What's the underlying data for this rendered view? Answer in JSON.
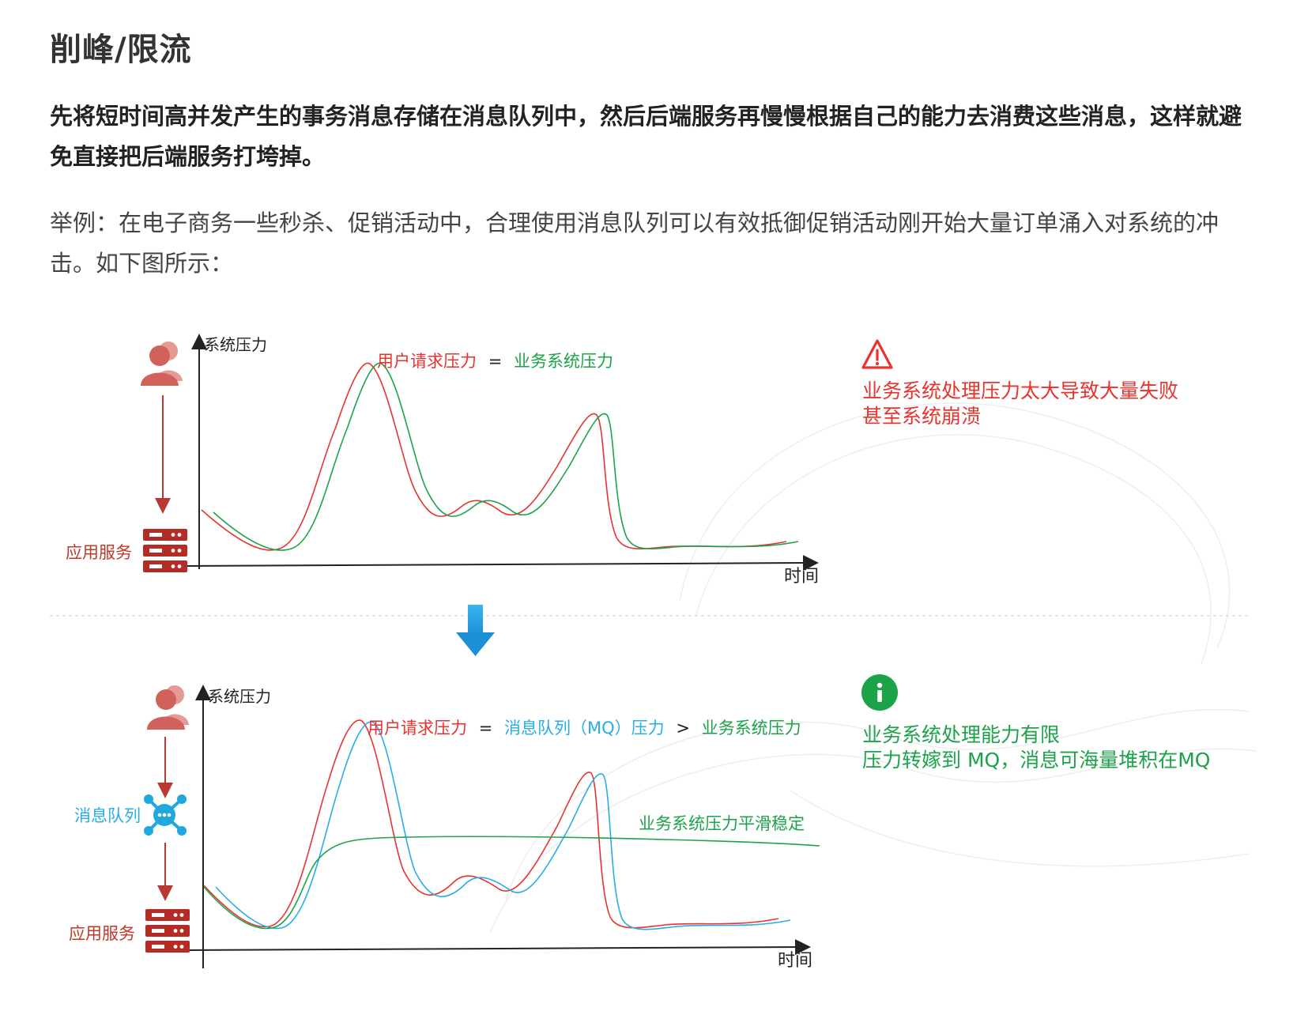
{
  "article": {
    "title": "削峰/限流",
    "lead": "先将短时间高并发产生的事务消息存储在消息队列中，然后后端服务再慢慢根据自己的能力去消费这些消息，这样就避免直接把后端服务打垮掉。",
    "example": "举例：在电子商务一些秒杀、促销活动中，合理使用消息队列可以有效抵御促销活动刚开始大量订单涌入对系统的冲击。如下图所示："
  },
  "top_diagram": {
    "y_axis_label": "系统压力",
    "x_axis_label": "时间",
    "legend": {
      "part1": "用户请求压力",
      "eq": "=",
      "part2": "业务系统压力"
    },
    "node_app_service": "应用服务",
    "warning_line1": "业务系统处理压力太大导致大量失败",
    "warning_line2": "甚至系统崩溃"
  },
  "bottom_diagram": {
    "y_axis_label": "系统压力",
    "x_axis_label": "时间",
    "legend": {
      "part1": "用户请求压力",
      "eq": "=",
      "part2": "消息队列（MQ）压力",
      "gt": ">",
      "part3": "业务系统压力"
    },
    "node_queue": "消息队列",
    "node_app_service": "应用服务",
    "smooth_label": "业务系统压力平滑稳定",
    "info_line1": "业务系统处理能力有限",
    "info_line2": "压力转嫁到 MQ，消息可海量堆积在MQ"
  },
  "colors": {
    "red": "#e8332f",
    "green": "#1ca34a",
    "blue": "#28aee6",
    "dark_red": "#b93a33",
    "axis": "#222222"
  },
  "icons": {
    "user": "users-icon",
    "server": "server-icon",
    "queue": "message-queue-icon",
    "warning": "warning-icon",
    "info": "info-icon",
    "down_arrow": "arrow-down-icon"
  }
}
